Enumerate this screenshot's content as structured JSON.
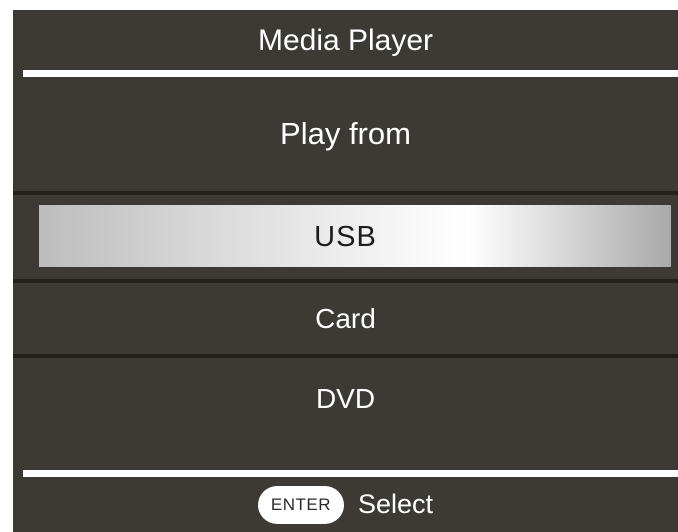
{
  "header": {
    "title": "Media Player"
  },
  "menu": {
    "prompt": "Play from",
    "items": [
      {
        "label": "USB",
        "selected": true
      },
      {
        "label": "Card",
        "selected": false
      },
      {
        "label": "DVD",
        "selected": false
      }
    ]
  },
  "footer": {
    "key_label": "ENTER",
    "action_label": "Select"
  },
  "colors": {
    "background": "#3d3935",
    "text": "#ffffff",
    "highlight": "#f4f4f4",
    "selected_text": "#1c1c1c"
  }
}
